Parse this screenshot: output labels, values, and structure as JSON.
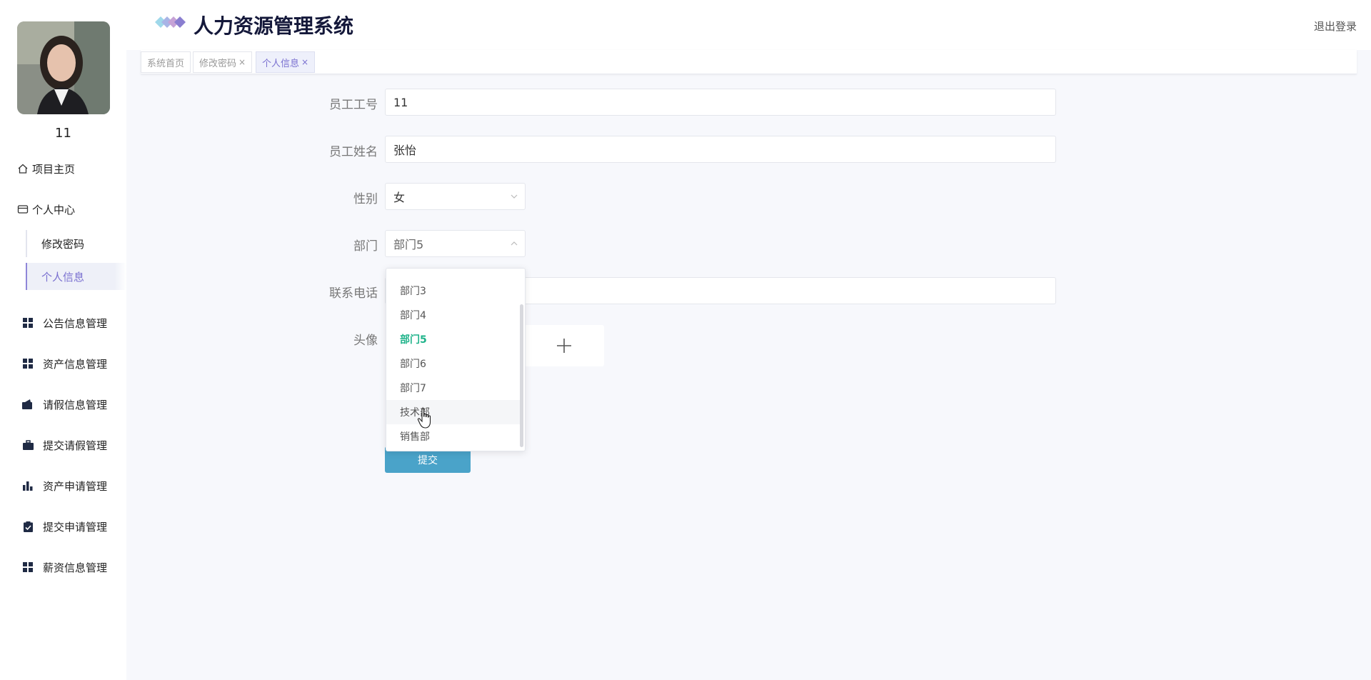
{
  "app": {
    "title": "人力资源管理系统",
    "logout_label": "退出登录"
  },
  "user": {
    "name": "11"
  },
  "sidebar": {
    "home_label": "项目主页",
    "personal_center_label": "个人中心",
    "sub_items": [
      "修改密码",
      "个人信息"
    ],
    "groups": [
      "公告信息管理",
      "资产信息管理",
      "请假信息管理",
      "提交请假管理",
      "资产申请管理",
      "提交申请管理",
      "薪资信息管理"
    ]
  },
  "tabs": [
    {
      "label": "系统首页",
      "closable": false
    },
    {
      "label": "修改密码",
      "closable": true
    },
    {
      "label": "个人信息",
      "closable": true
    }
  ],
  "tab_close_glyph": "×",
  "form": {
    "employee_id": {
      "label": "员工工号",
      "value": "11"
    },
    "employee_name": {
      "label": "员工姓名",
      "value": "张怡"
    },
    "gender": {
      "label": "性别",
      "value": "女"
    },
    "department": {
      "label": "部门",
      "value": "部门5"
    },
    "phone": {
      "label": "联系电话",
      "value": ""
    },
    "avatar": {
      "label": "头像"
    },
    "submit_label": "提交"
  },
  "department_dropdown": {
    "options": [
      "部门3",
      "部门4",
      "部门5",
      "部门6",
      "部门7",
      "技术部",
      "销售部"
    ],
    "selected": "部门5",
    "hovered": "技术部"
  },
  "colors": {
    "accent": "#7a70d0",
    "selected_option": "#1fb38a",
    "submit_button": "#4aa3c9",
    "title": "#14183a"
  }
}
